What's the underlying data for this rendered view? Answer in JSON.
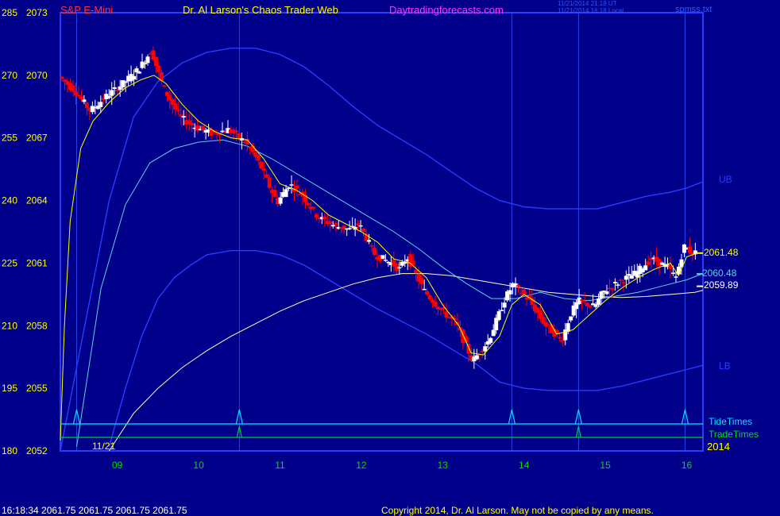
{
  "header": {
    "symbol": "S&P E-Mini",
    "title": "Dr. Al Larson's Chaos Trader Web",
    "site": "Daytradingforecasts.com",
    "stamp1": "11/21/2014 21:18 UT",
    "stamp2": "11/21/2014 16:18 Local",
    "file": "spmss.txt"
  },
  "footer": {
    "quote": "16:18:34  2061.75  2061.75  2061.75  2061.75",
    "copyright": "Copyright 2014, Dr. Al Larson. May not be copied by any means."
  },
  "labels": {
    "ub": "UB",
    "lb": "LB",
    "price1": "2061.48",
    "price2": "2060.48",
    "price3": "2059.89",
    "tide": "TideTimes",
    "trade": "TradeTimes",
    "date_marker": "11/21",
    "year": "2014"
  },
  "colors": {
    "background": "#00008b",
    "up_bar": "#ffffff",
    "down_bar": "#ff0000",
    "ema_fast": "#ffff00",
    "ema_mid": "#5fd0e0",
    "ema_slow": "#fffec0",
    "band": "#2a3cff",
    "tide": "#00e5ff",
    "trade": "#00cc33",
    "label_yellow": "#ffff00",
    "label_green": "#00dd00",
    "label_magenta": "#ff33ff",
    "label_red": "#ff3333"
  },
  "chart_data": {
    "type": "candlestick",
    "x_ticks": [
      "09",
      "10",
      "11",
      "12",
      "13",
      "14",
      "15",
      "16"
    ],
    "y_left_ticks": [
      "285",
      "270",
      "255",
      "240",
      "225",
      "210",
      "195",
      "180"
    ],
    "y_right_ticks": [
      "2073",
      "2070",
      "2067",
      "2064",
      "2061",
      "2058",
      "2055",
      "2052"
    ],
    "ylim": [
      2052,
      2073
    ],
    "xlim": [
      8.3,
      16.2
    ],
    "series": [
      {
        "name": "price",
        "x": [
          8.3,
          8.5,
          8.7,
          8.9,
          9.1,
          9.3,
          9.45,
          9.6,
          9.8,
          10.0,
          10.2,
          10.4,
          10.6,
          10.7,
          10.8,
          10.9,
          11.0,
          11.15,
          11.3,
          11.5,
          11.7,
          11.9,
          12.0,
          12.2,
          12.4,
          12.5,
          12.6,
          12.8,
          13.0,
          13.2,
          13.4,
          13.6,
          13.8,
          13.9,
          14.1,
          14.3,
          14.5,
          14.6,
          14.7,
          14.9,
          15.0,
          15.2,
          15.4,
          15.6,
          15.8,
          15.9,
          16.0,
          16.1
        ],
        "y": [
          2070,
          2069.3,
          2068.3,
          2069,
          2069.6,
          2070.3,
          2071.2,
          2069.4,
          2068,
          2067.5,
          2067.2,
          2067.4,
          2066.8,
          2066.3,
          2065.6,
          2064.7,
          2063.9,
          2064.8,
          2064.3,
          2063.2,
          2062.8,
          2062.6,
          2062.9,
          2061.4,
          2061,
          2060.7,
          2061.3,
          2059.7,
          2058.8,
          2058.1,
          2056.3,
          2057.3,
          2059.3,
          2060,
          2059.2,
          2058,
          2057.3,
          2058.5,
          2059.2,
          2058.9,
          2059.6,
          2060.1,
          2060.5,
          2061.2,
          2060.8,
          2060.3,
          2061.8,
          2061.5
        ]
      },
      {
        "name": "ema_fast",
        "x": [
          8.3,
          8.35,
          8.42,
          8.55,
          8.7,
          8.9,
          9.1,
          9.3,
          9.45,
          9.6,
          9.8,
          10.0,
          10.2,
          10.4,
          10.6,
          10.8,
          11.0,
          11.2,
          11.4,
          11.6,
          11.8,
          12.0,
          12.2,
          12.4,
          12.6,
          12.8,
          13.0,
          13.2,
          13.35,
          13.5,
          13.7,
          13.85,
          14.0,
          14.2,
          14.4,
          14.6,
          14.8,
          15.0,
          15.2,
          15.4,
          15.6,
          15.8,
          15.9,
          16.0,
          16.15
        ],
        "y": [
          2052.5,
          2058,
          2063,
          2066.5,
          2067.8,
          2068.7,
          2069.4,
          2069.8,
          2070,
          2069.6,
          2068.6,
          2067.8,
          2067.3,
          2067,
          2066.9,
          2066,
          2064.8,
          2064.5,
          2064,
          2063.3,
          2062.9,
          2062.5,
          2062,
          2061.2,
          2061,
          2060.3,
          2059,
          2058,
          2056.7,
          2056.6,
          2057.5,
          2059,
          2059.5,
          2059,
          2057.6,
          2057.8,
          2058.5,
          2059.2,
          2059.8,
          2060.3,
          2060.7,
          2061,
          2060.4,
          2061.3,
          2061.5
        ]
      },
      {
        "name": "ema_mid",
        "x": [
          8.5,
          8.8,
          9.1,
          9.4,
          9.7,
          10.0,
          10.3,
          10.6,
          10.9,
          11.2,
          11.5,
          11.8,
          12.1,
          12.4,
          12.7,
          13.0,
          13.3,
          13.6,
          13.9,
          14.2,
          14.5,
          14.8,
          15.1,
          15.4,
          15.7,
          16.0,
          16.2
        ],
        "y": [
          2052.2,
          2059.8,
          2063.8,
          2065.8,
          2066.5,
          2066.8,
          2066.9,
          2066.6,
          2066,
          2065.3,
          2064.6,
          2063.9,
          2063.2,
          2062.5,
          2061.7,
          2060.8,
          2060,
          2059.3,
          2059.3,
          2059.6,
          2059.3,
          2059.2,
          2059.4,
          2059.6,
          2059.9,
          2060.2,
          2060.5
        ]
      },
      {
        "name": "ema_slow",
        "x": [
          8.9,
          9.2,
          9.5,
          9.8,
          10.1,
          10.4,
          10.7,
          11.0,
          11.3,
          11.6,
          11.9,
          12.2,
          12.5,
          12.8,
          13.1,
          13.4,
          13.7,
          14.0,
          14.3,
          14.6,
          14.9,
          15.2,
          15.5,
          15.8,
          16.1,
          16.2
        ],
        "y": [
          2052,
          2053.8,
          2055,
          2056,
          2056.8,
          2057.5,
          2058.1,
          2058.7,
          2059.2,
          2059.6,
          2060,
          2060.3,
          2060.5,
          2060.5,
          2060.4,
          2060.2,
          2060,
          2059.8,
          2059.6,
          2059.5,
          2059.4,
          2059.35,
          2059.4,
          2059.5,
          2059.6,
          2059.7
        ]
      },
      {
        "name": "upper_band",
        "x": [
          8.3,
          8.6,
          8.9,
          9.2,
          9.5,
          9.8,
          10.1,
          10.4,
          10.7,
          11.0,
          11.3,
          11.6,
          11.9,
          12.2,
          12.5,
          12.8,
          13.1,
          13.4,
          13.7,
          14.0,
          14.3,
          14.6,
          14.9,
          15.2,
          15.5,
          15.8,
          16.0,
          16.2
        ],
        "y": [
          2052,
          2058,
          2064,
          2068,
          2069.7,
          2070.6,
          2071.1,
          2071.3,
          2071.3,
          2071,
          2070.4,
          2069.5,
          2068.5,
          2067.6,
          2066.9,
          2066.2,
          2065.4,
          2064.6,
          2064,
          2063.7,
          2063.6,
          2063.6,
          2063.6,
          2063.9,
          2064.2,
          2064.4,
          2064.6,
          2064.9
        ]
      },
      {
        "name": "lower_band",
        "x": [
          8.9,
          9.1,
          9.3,
          9.5,
          9.7,
          9.9,
          10.1,
          10.4,
          10.7,
          11.0,
          11.3,
          11.6,
          11.9,
          12.2,
          12.5,
          12.8,
          13.1,
          13.4,
          13.7,
          14.0,
          14.3,
          14.6,
          14.9,
          15.2,
          15.5,
          15.8,
          16.0,
          16.2
        ],
        "y": [
          2052.2,
          2055,
          2057.5,
          2059.3,
          2060.3,
          2060.9,
          2061.4,
          2061.6,
          2061.6,
          2061.4,
          2060.9,
          2060.2,
          2059.5,
          2058.8,
          2058.2,
          2057.6,
          2056.9,
          2056.2,
          2055.3,
          2055,
          2054.9,
          2054.9,
          2054.9,
          2055.1,
          2055.4,
          2055.7,
          2055.9,
          2056.1
        ]
      }
    ],
    "tide_times": [
      8.5,
      10.5,
      13.85,
      14.67,
      15.98
    ],
    "trade_times": [
      10.5,
      14.67
    ],
    "current_values": [
      "2061.48",
      "2060.48",
      "2059.89"
    ]
  }
}
